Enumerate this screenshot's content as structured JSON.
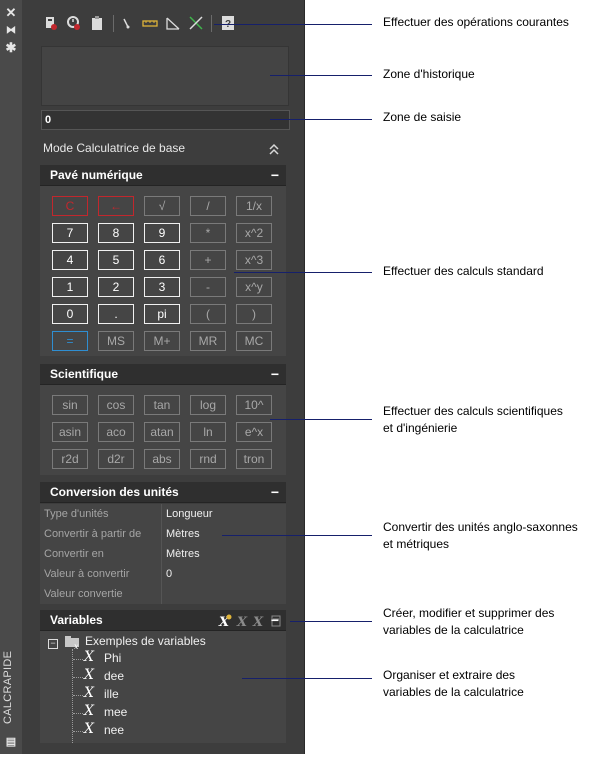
{
  "window": {
    "vertical_title": "CALCRAPIDE"
  },
  "input": {
    "value": "0"
  },
  "mode": {
    "label": "Mode Calculatrice de base",
    "toggle_icon": "chevron-double-up-icon"
  },
  "keypad": {
    "title": "Pavé numérique",
    "collapse": "−",
    "rows": [
      [
        "C",
        "←",
        "√",
        "/",
        "1/x"
      ],
      [
        "7",
        "8",
        "9",
        "*",
        "x^2"
      ],
      [
        "4",
        "5",
        "6",
        "+",
        "x^3"
      ],
      [
        "1",
        "2",
        "3",
        "-",
        "x^y"
      ],
      [
        "0",
        ".",
        "pi",
        "(",
        ")"
      ],
      [
        "=",
        "MS",
        "M+",
        "MR",
        "MC"
      ]
    ]
  },
  "scientific": {
    "title": "Scientifique",
    "collapse": "−",
    "rows": [
      [
        "sin",
        "cos",
        "tan",
        "log",
        "10^"
      ],
      [
        "asin",
        "aco",
        "atan",
        "ln",
        "e^x"
      ],
      [
        "r2d",
        "d2r",
        "abs",
        "rnd",
        "tron"
      ]
    ]
  },
  "units": {
    "title": "Conversion des unités",
    "collapse": "−",
    "rows": [
      {
        "key": "Type d'unités",
        "value": "Longueur"
      },
      {
        "key": "Convertir à partir de",
        "value": "Mètres"
      },
      {
        "key": "Convertir en",
        "value": "Mètres"
      },
      {
        "key": "Valeur à convertir",
        "value": "0"
      },
      {
        "key": "Valeur convertie",
        "value": ""
      }
    ]
  },
  "variables": {
    "title": "Variables",
    "collapse": "−",
    "group": "Exemples de variables",
    "items": [
      "Phi",
      "dee",
      "ille",
      "mee",
      "nee"
    ]
  },
  "annotations": {
    "ops": "Effectuer des opérations courantes",
    "history": "Zone d'historique",
    "input": "Zone de saisie",
    "standard": "Effectuer des calculs standard",
    "sci_1": "Effectuer des calculs scientifiques",
    "sci_2": "et d'ingénierie",
    "conv_1": "Convertir des unités anglo-saxonnes",
    "conv_2": "et métriques",
    "vars_1": "Créer, modifier et supprimer des",
    "vars_2": "variables de la calculatrice",
    "org_1": "Organiser et extraire des",
    "org_2": "variables de la calculatrice"
  },
  "colors": {
    "panel": "#3d3d3d",
    "header": "#2f2f2f",
    "red": "#c2272d",
    "blue": "#2f8ed1",
    "leader": "#16206b"
  }
}
